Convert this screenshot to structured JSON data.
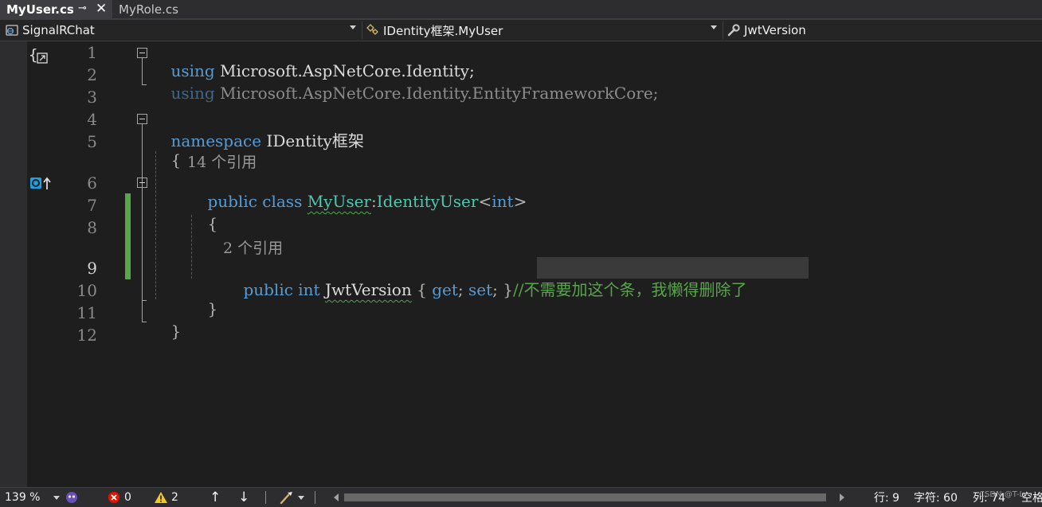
{
  "tabs": [
    {
      "label": "MyUser.cs",
      "active": true
    },
    {
      "label": "MyRole.cs",
      "active": false
    }
  ],
  "navbar": {
    "project": "SignalRChat",
    "type": "IDentity框架.MyUser",
    "member": "JwtVersion"
  },
  "editor": {
    "line_numbers": [
      "1",
      "2",
      "3",
      "4",
      "5",
      "6",
      "7",
      "8",
      "9",
      "10",
      "11",
      "12"
    ],
    "current_line": "9",
    "lens_class": "14 个引用",
    "lens_prop": "2 个引用",
    "line1": {
      "kw": "using",
      "rest": " Microsoft.AspNetCore.Identity;"
    },
    "line2": {
      "kw": "using",
      "rest": " Microsoft.AspNetCore.Identity.EntityFrameworkCore;"
    },
    "line4": {
      "kw": "namespace",
      "rest": " IDentity框架"
    },
    "brace_open": "{",
    "brace_close": "}",
    "line6": {
      "kw1": "public",
      "kw2": "class",
      "name": "MyUser",
      "colon": ":",
      "base": "IdentityUser",
      "lt": "<",
      "arg": "int",
      "gt": ">"
    },
    "line9": {
      "kw1": "public",
      "kw2": "int",
      "name": "JwtVersion",
      "ob": " {",
      "get": "get",
      "semi1": ";",
      "set": "set",
      "semi2": ";",
      "cb": " }",
      "comment": "//不需要加这个条，我懒得删除了"
    }
  },
  "status": {
    "zoom": "139 %",
    "errors": "0",
    "warnings": "2",
    "line": "行: 9",
    "char": "字符: 60",
    "col": "列: 74",
    "space": "空格",
    "watermark": "CSDN @T-Ly"
  },
  "colors": {
    "keyword": "#569cd6",
    "type": "#4ec9b0",
    "comment": "#57a64a",
    "change_bar": "#57a64a",
    "background": "#1e1e1e"
  }
}
